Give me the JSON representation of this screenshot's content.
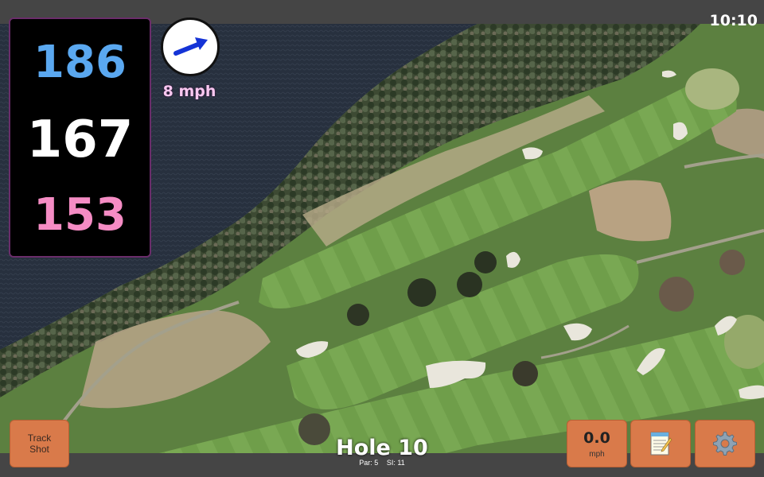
{
  "status": {
    "time": "10:10"
  },
  "distances": {
    "back": "186",
    "middle": "167",
    "front": "153"
  },
  "wind": {
    "speed": "8 mph",
    "direction_icon": "arrow-icon",
    "arrow_color": "#1433d6"
  },
  "hole": {
    "title": "Hole 10",
    "par_label": "Par: 5",
    "si_label": "SI: 11"
  },
  "buttons": {
    "track_shot_line1": "Track",
    "track_shot_line2": "Shot",
    "speed_value": "0.0",
    "speed_unit": "mph",
    "notes_icon": "notepad-icon",
    "settings_icon": "gear-icon"
  },
  "colors": {
    "back_distance": "#5aa8f0",
    "middle_distance": "#ffffff",
    "front_distance": "#f58cc4",
    "button_orange": "#d97a4a",
    "water": "#2a3140",
    "fairway": "#6e9b48",
    "rough": "#4f7a36"
  }
}
